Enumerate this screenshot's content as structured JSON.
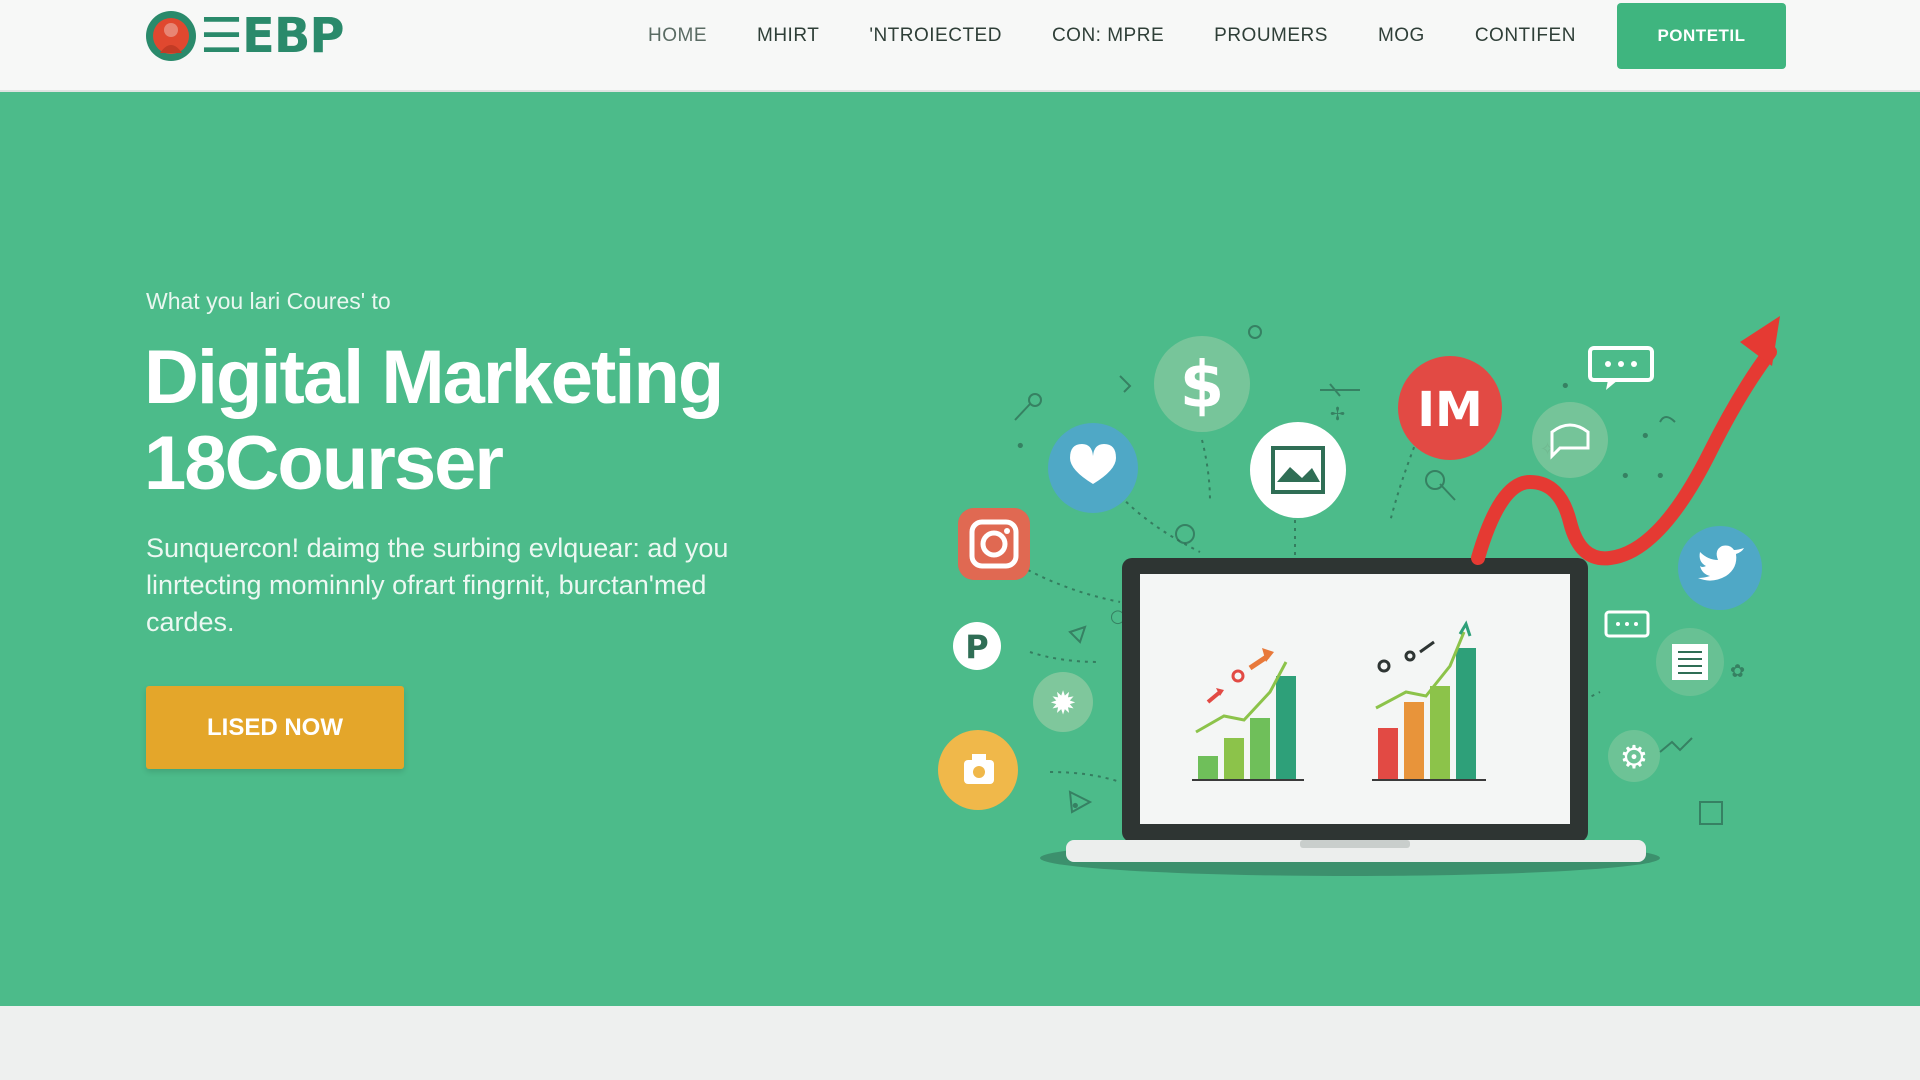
{
  "brand": {
    "logo_text": "EBP"
  },
  "nav": {
    "items": [
      "HOME",
      "MHIRT",
      "'NTROIECTED",
      "CON: MPRE",
      "PROUMERS",
      "MOG",
      "CONTIFEN"
    ],
    "cta_label": "PONTETIL"
  },
  "hero": {
    "kicker": "What you lari Coures' to",
    "title_line1": "Digital Marketing",
    "title_line2": "18Courser",
    "description": "Sunquercon! daimg the surbing evlquear: ad you linrtecting mominnly ofrart fingrnit, burctan'med cardes.",
    "button_label": "LISED NOW"
  },
  "illustration": {
    "badge_text": "IM",
    "dollar_symbol": "$",
    "p_badge": "P",
    "icons": [
      "dollar-icon",
      "im-badge-icon",
      "instagram-icon",
      "heart-chat-icon",
      "image-icon",
      "twitter-icon",
      "p-badge-icon",
      "camera-icon",
      "gear-icon",
      "document-icon",
      "chat-icon",
      "laptop-icon",
      "trend-arrow-icon"
    ]
  },
  "colors": {
    "brand_green": "#3fb57f",
    "hero_bg": "#4cbb8a",
    "button_orange": "#e4a62a",
    "logo_red": "#e0482f",
    "logo_teal": "#2a8a6b",
    "logo_orange": "#e07a2c"
  }
}
